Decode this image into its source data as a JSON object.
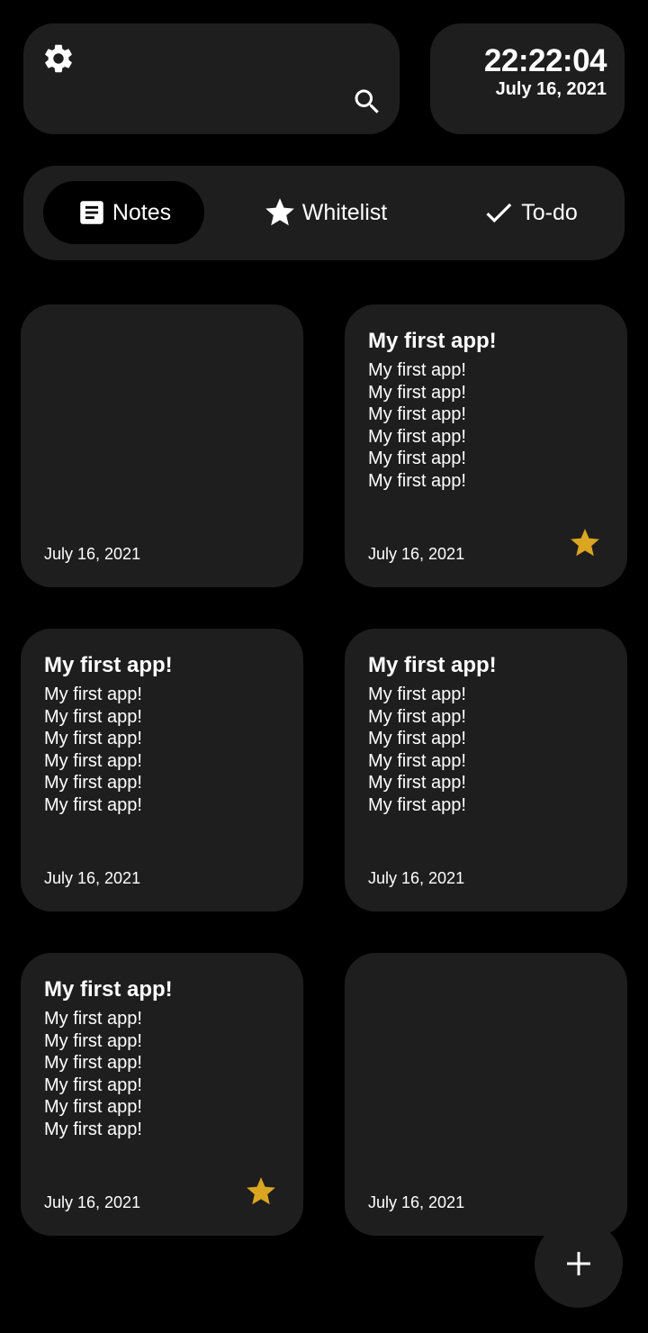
{
  "header": {
    "settings_icon": "gear-icon",
    "search_icon": "search-icon"
  },
  "clock": {
    "time": "22:22:04",
    "date": "July 16, 2021"
  },
  "tabs": [
    {
      "label": "Notes",
      "icon": "note-icon",
      "selected": true
    },
    {
      "label": "Whitelist",
      "icon": "star-icon",
      "selected": false
    },
    {
      "label": "To-do",
      "icon": "check-icon",
      "selected": false
    }
  ],
  "notes": [
    {
      "title": "",
      "body": "",
      "date": "July 16, 2021",
      "starred": false
    },
    {
      "title": "My first app!",
      "body": "My first app!\nMy first app!\nMy first app!\nMy first app!\nMy first app!\nMy first app!",
      "date": "July 16, 2021",
      "starred": true
    },
    {
      "title": "My first app!",
      "body": "My first app!\nMy first app!\nMy first app!\nMy first app!\nMy first app!\nMy first app!",
      "date": "July 16, 2021",
      "starred": false
    },
    {
      "title": "My first app!",
      "body": "My first app!\nMy first app!\nMy first app!\nMy first app!\nMy first app!\nMy first app!",
      "date": "July 16, 2021",
      "starred": false
    },
    {
      "title": "My first app!",
      "body": "My first app!\nMy first app!\nMy first app!\nMy first app!\nMy first app!\nMy first app!",
      "date": "July 16, 2021",
      "starred": true
    },
    {
      "title": "",
      "body": "",
      "date": "July 16, 2021",
      "starred": false
    }
  ],
  "fab": {
    "icon": "plus-icon"
  },
  "colors": {
    "background": "#000000",
    "surface": "#1e1e1e",
    "star": "#daa520",
    "text": "#ffffff"
  }
}
